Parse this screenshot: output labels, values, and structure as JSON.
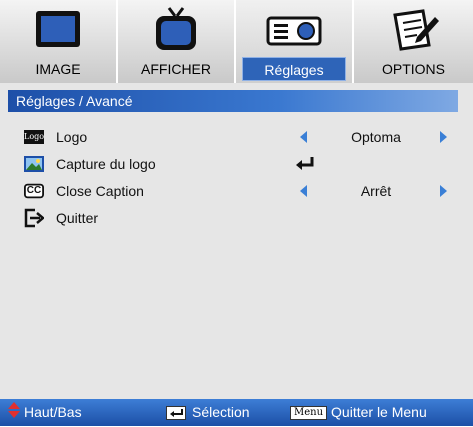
{
  "tabs": [
    {
      "label": "IMAGE",
      "icon": "monitor-icon"
    },
    {
      "label": "AFFICHER",
      "icon": "tv-icon"
    },
    {
      "label": "Réglages",
      "icon": "projector-icon",
      "active": true
    },
    {
      "label": "OPTIONS",
      "icon": "notepad-pen-icon"
    }
  ],
  "breadcrumb": "Réglages / Avancé",
  "rows": [
    {
      "label": "Logo",
      "icon_text": "Logo",
      "value": "Optoma"
    },
    {
      "label": "Capture du logo"
    },
    {
      "label": "Close Caption",
      "icon_text": "CC",
      "value": "Arrêt"
    },
    {
      "label": "Quitter"
    }
  ],
  "footer": {
    "updown": "Haut/Bas",
    "select": "Sélection",
    "menu_key": "Menu",
    "menu_label": "Quitter le Menu"
  },
  "colors": {
    "accent": "#2e64b8",
    "arrow": "#3a7fd6",
    "footer": "#1c4fa6",
    "updown_icon": "#e03030"
  }
}
